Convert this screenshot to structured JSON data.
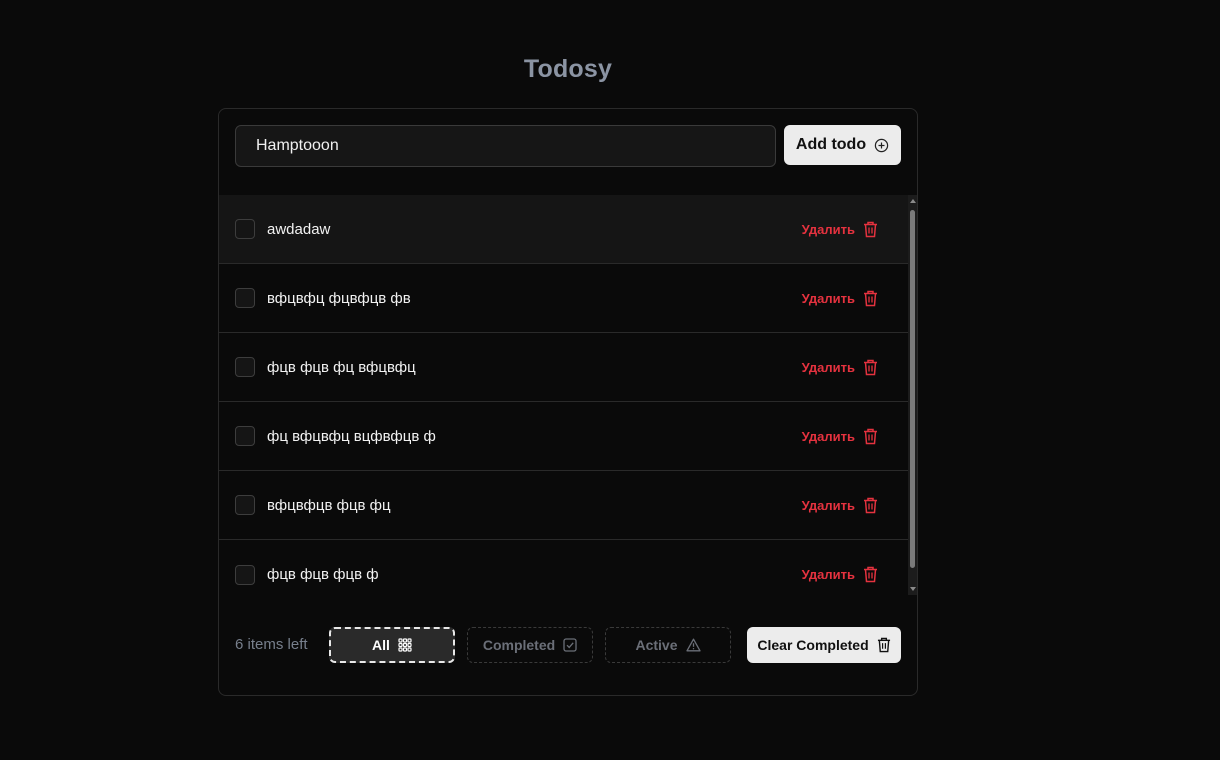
{
  "app": {
    "title": "Todosy"
  },
  "input": {
    "value": "Hamptooon",
    "add_label": "Add todo"
  },
  "todos": [
    {
      "text": "awdadaw",
      "completed": false,
      "delete_label": "Удалить"
    },
    {
      "text": "вфцвфц фцвфцв фв",
      "completed": false,
      "delete_label": "Удалить"
    },
    {
      "text": "фцв фцв фц вфцвфц",
      "completed": false,
      "delete_label": "Удалить"
    },
    {
      "text": "фц вфцвфц вцфвфцв ф",
      "completed": false,
      "delete_label": "Удалить"
    },
    {
      "text": "вфцвфцв фцв фц",
      "completed": false,
      "delete_label": "Удалить"
    },
    {
      "text": "фцв фцв фцв ф",
      "completed": false,
      "delete_label": "Удалить"
    }
  ],
  "footer": {
    "items_left": "6 items left",
    "filters": [
      {
        "label": "All",
        "icon": "grid-icon",
        "selected": true
      },
      {
        "label": "Completed",
        "icon": "check-square-icon",
        "selected": false
      },
      {
        "label": "Active",
        "icon": "warning-triangle-icon",
        "selected": false
      }
    ],
    "clear_label": "Clear Completed"
  },
  "colors": {
    "background": "#0a0a0a",
    "danger": "#e5323f",
    "title": "#8b94a3",
    "button_bg": "#ececec"
  }
}
